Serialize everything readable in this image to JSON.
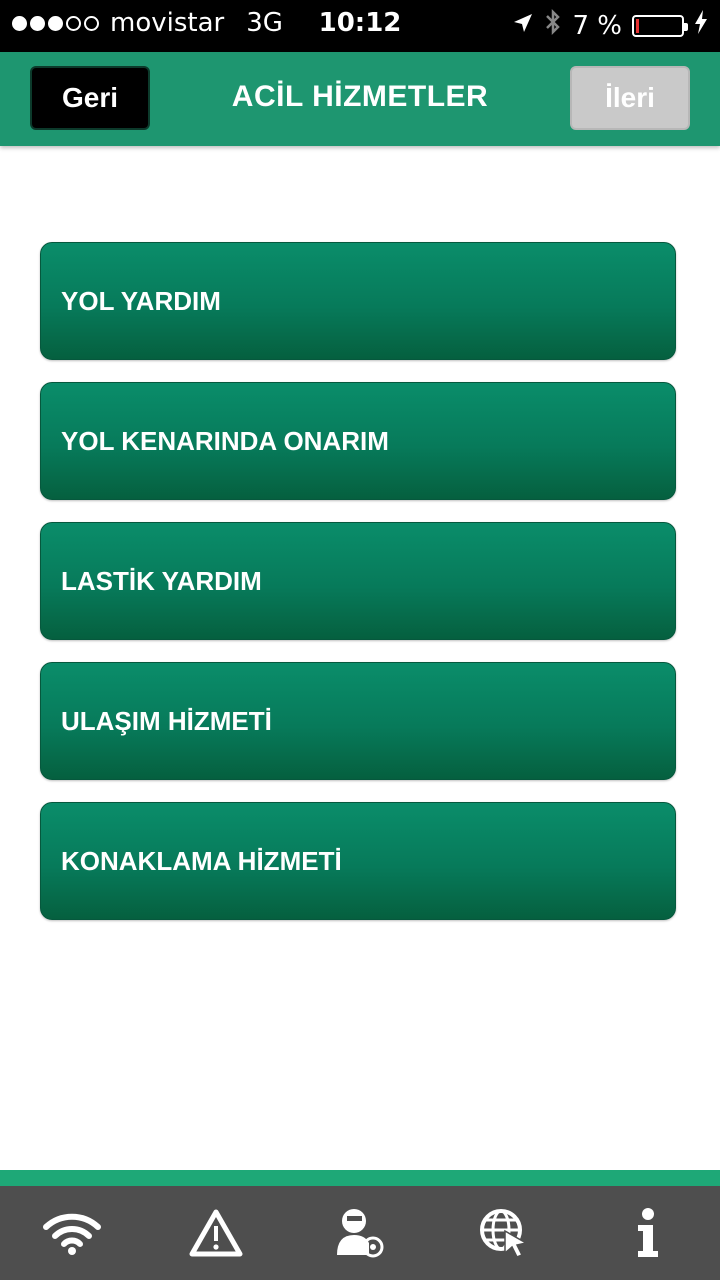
{
  "status_bar": {
    "carrier": "movistar",
    "network": "3G",
    "time": "10:12",
    "battery_text": "7 %",
    "battery_level_percent": 7,
    "signal_bars_filled": 3,
    "signal_bars_total": 5
  },
  "nav": {
    "back_label": "Geri",
    "title": "ACİL HİZMETLER",
    "next_label": "İleri"
  },
  "menu": {
    "items": [
      {
        "label": "YOL YARDIM"
      },
      {
        "label": "YOL KENARINDA ONARIM"
      },
      {
        "label": "LASTİK YARDIM"
      },
      {
        "label": "ULAŞIM HİZMETİ"
      },
      {
        "label": "KONAKLAMA HİZMETİ"
      }
    ]
  },
  "tab_bar": {
    "icons": [
      "wifi-icon",
      "warning-icon",
      "user-settings-icon",
      "globe-cursor-icon",
      "info-icon"
    ]
  },
  "colors": {
    "header": "#1e9670",
    "menu_button": "#077a5a",
    "tab_bar": "#4e4e4e",
    "accent": "#1ea877"
  }
}
